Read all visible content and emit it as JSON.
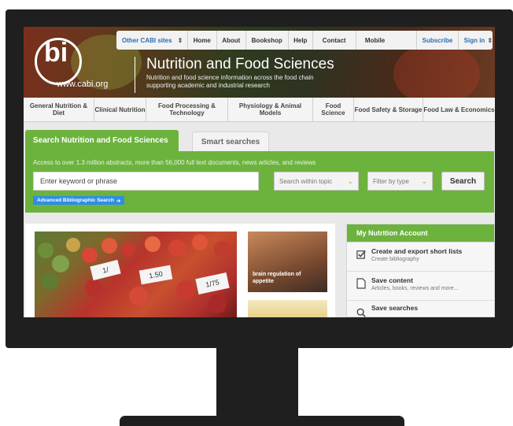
{
  "topnav": {
    "items": [
      "Other CABI sites",
      "Home",
      "About",
      "Bookshop",
      "Help",
      "Contact",
      "Mobile",
      "Subscribe",
      "Sign in"
    ]
  },
  "brand": {
    "url": "www.cabi.org",
    "title": "Nutrition and Food Sciences",
    "subtitle": "Nutrition and food science information across the food chain supporting academic and industrial research"
  },
  "categories": [
    "General Nutrition & Diet",
    "Clinical Nutrition",
    "Food Processing & Technology",
    "Physiology & Animal Models",
    "Food Science",
    "Food Safety & Storage",
    "Food Law & Economics"
  ],
  "search": {
    "tab_active": "Search Nutrition and Food Sciences",
    "tab_other": "Smart searches",
    "access_text": "Access to over 1.3 million abstracts, more than 56,000 full text documents, news articles, and reviews",
    "placeholder": "Enter keyword or phrase",
    "topic_select": "Search within topic",
    "type_select": "Filter by type",
    "button": "Search",
    "advanced": "Advanced Bibliographic Search"
  },
  "feature": {
    "card_caption": "brain regulation of appetite",
    "price_tags": [
      "1/",
      "1.50",
      "1/75"
    ]
  },
  "account": {
    "heading": "My Nutrition Account",
    "items": [
      {
        "title": "Create and export short lists",
        "desc": "Create bibliography",
        "icon": "checkbox-icon"
      },
      {
        "title": "Save content",
        "desc": "Articles, books, reviews and more...",
        "icon": "document-icon"
      },
      {
        "title": "Save searches",
        "desc": "",
        "icon": "search-icon"
      }
    ]
  },
  "colors": {
    "green": "#6cb33e",
    "blue_link": "#2a6db5",
    "orange": "#f08a1c",
    "monitor": "#1f1f1f"
  }
}
